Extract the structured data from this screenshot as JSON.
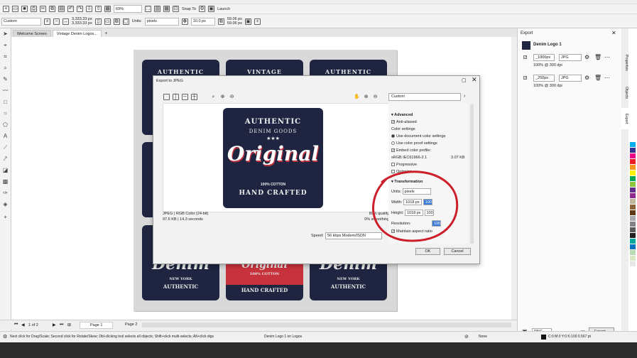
{
  "toolbar": {
    "zoom": "69%",
    "snap": "Snap To",
    "launch": "Launch",
    "preset": "Custom",
    "x_value": "3,333.33 px",
    "y_value": "3,333.33 px",
    "units_label": "Units:",
    "units_value": "pixels",
    "nudge": "10.0 px",
    "dup_x": "59.06 px",
    "dup_y": "59.06 px"
  },
  "tabs": {
    "welcome": "Welcome Screen",
    "document": "Vintage Denim Logos..."
  },
  "cards": {
    "authentic": "AUTHENTIC",
    "vintage": "VINTAGE",
    "denim": "Denim",
    "new_york": "NEW YORK",
    "original": "Original",
    "cotton": "100% COTTON",
    "hand_crafted": "HAND CRAFTED"
  },
  "dialog": {
    "title": "Export to JPEG",
    "preset": "Custom",
    "logo": {
      "authentic": "AUTHENTIC",
      "denim_goods": "DENIM GOODS",
      "stars": "★★★",
      "original": "Original",
      "cotton": "100% COTTON",
      "hand_crafted": "HAND CRAFTED"
    },
    "info_format": "JPEG  |  RGB Color (24-bit)",
    "info_size": "97.6 KB  |  14.3 seconds",
    "info_quality": "80% quality",
    "info_smoothing": "0% smoothing",
    "speed_label": "Speed:",
    "speed_value": "56 kbps Modem/ISDN",
    "advanced": {
      "header": "Advanced",
      "anti_aliased": "Anti-aliased",
      "color_settings": "Color settings",
      "use_document": "Use document color settings",
      "use_proof": "Use color proof settings",
      "embed_profile": "Embed color profile:",
      "profile_name": "sRGB IEC61966-2.1",
      "profile_size": "3.07 KB",
      "progressive": "Progressive",
      "optimize": "Optimize"
    },
    "transformation": {
      "header": "Transformation",
      "units_label": "Units:",
      "units_value": "pixels",
      "width_label": "Width:",
      "width_value": "1018 px",
      "width_pct": "100",
      "height_label": "Height:",
      "height_value": "1018 px",
      "height_pct": "100",
      "resolution_label": "Resolution:",
      "resolution_value": "100",
      "maintain_aspect": "Maintain aspect ratio"
    },
    "ok": "OK",
    "cancel": "Cancel"
  },
  "export_panel": {
    "title": "Export",
    "item_name": "Denim Logo 1",
    "row1_size": "_1000px",
    "row1_format": "JPG",
    "row1_info": "100% @ 300 dpi",
    "row2_size": "_250px",
    "row2_format": "JPG",
    "row2_info": "100% @ 300 dpi",
    "format": "PNG",
    "export_button": "Export...",
    "side_tabs": [
      "Properties",
      "Objects",
      "Export"
    ]
  },
  "pages": {
    "count": "1 of 2",
    "page1": "Page 1",
    "page2": "Page 2"
  },
  "status": {
    "hint": "Next click for Drag/Scale; Second click for Rotate/Skew; Dbl-clicking tool selects all objects; Shift+click multi-selects; Alt+click digs",
    "object": "Denim Logo 1 on Logos",
    "fill": "None",
    "color": "C:0 M:0 Y:0 K:100  0.567 pt"
  },
  "colors": {
    "navy": "#1f2540",
    "red": "#c8323c",
    "highlight": "#cc1f2a"
  }
}
